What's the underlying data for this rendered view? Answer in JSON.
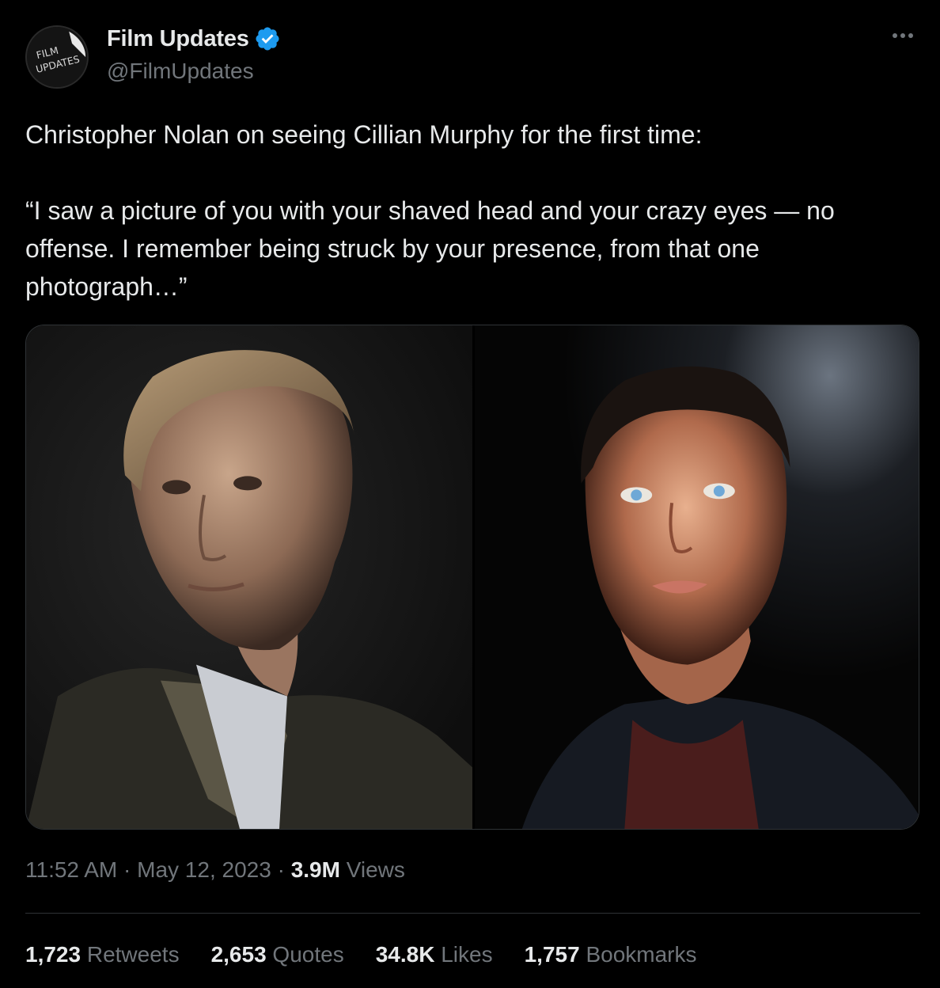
{
  "account": {
    "display_name": "Film Updates",
    "handle": "@FilmUpdates",
    "avatar_text": [
      "FILM",
      "UPDATES"
    ],
    "verified": true,
    "verified_color": "#1d9bf0"
  },
  "menu": {
    "icon": "more-horizontal-icon"
  },
  "tweet": {
    "lines": [
      "Christopher Nolan on seeing Cillian Murphy for the first time:",
      "",
      "“I saw a picture of you with your shaved head and your crazy eyes — no offense. I remember being struck by your presence, from that one photograph…”"
    ]
  },
  "media": {
    "photos": [
      "photo-christopher-nolan",
      "photo-cillian-murphy"
    ]
  },
  "meta": {
    "time": "11:52 AM",
    "sep1": " · ",
    "date": "May 12, 2023",
    "sep2": " · ",
    "views_count": "3.9M",
    "views_label": " Views"
  },
  "stats": [
    {
      "count": "1,723",
      "label": " Retweets"
    },
    {
      "count": "2,653",
      "label": " Quotes"
    },
    {
      "count": "34.8K",
      "label": " Likes"
    },
    {
      "count": "1,757",
      "label": " Bookmarks"
    }
  ],
  "colors": {
    "background": "#000000",
    "text_primary": "#e7e9ea",
    "text_secondary": "#71767b",
    "border": "#2f3336"
  }
}
